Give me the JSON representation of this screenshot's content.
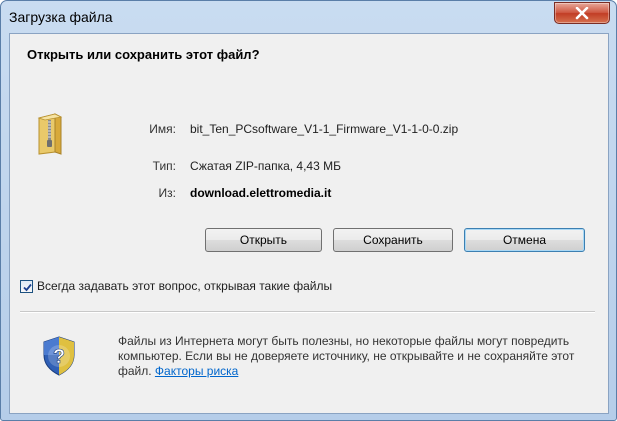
{
  "window": {
    "title": "Загрузка файла",
    "close_icon": "close-icon"
  },
  "dialog": {
    "question": "Открыть или сохранить этот файл?",
    "file_icon": "zip-folder-icon",
    "fields": {
      "name_label": "Имя:",
      "name_value": "bit_Ten_PCsoftware_V1-1_Firmware_V1-1-0-0.zip",
      "type_label": "Тип:",
      "type_value": "Сжатая ZIP-папка, 4,43 МБ",
      "from_label": "Из:",
      "from_value": "download.elettromedia.it"
    },
    "buttons": {
      "open": "Открыть",
      "save": "Сохранить",
      "cancel": "Отмена"
    },
    "always_ask": {
      "label": "Всегда задавать этот вопрос, открывая такие файлы",
      "checked": true
    },
    "warning": {
      "icon": "shield-question-icon",
      "text": "Файлы из Интернета могут быть полезны, но некоторые файлы могут повредить компьютер. Если вы не доверяете источнику, не открывайте и не сохраняйте этот файл. ",
      "link": "Факторы риска"
    }
  },
  "colors": {
    "frame": "#b5cde9",
    "close_button": "#c13d25",
    "link": "#0066cc"
  }
}
